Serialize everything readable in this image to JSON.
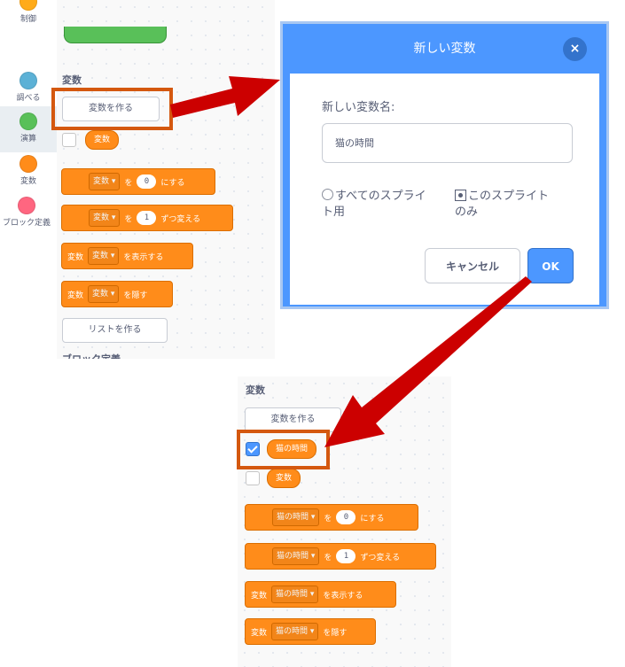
{
  "categories": [
    {
      "label": "制御",
      "color": "#ffab19"
    },
    {
      "label": "調べる",
      "color": "#5cb1d6"
    },
    {
      "label": "演算",
      "color": "#59c059"
    },
    {
      "label": "変数",
      "color": "#ff8c1a"
    },
    {
      "label": "ブロック定義",
      "color": "#ff6680"
    }
  ],
  "palette": {
    "section_title": "変数",
    "make_variable_label": "変数を作る",
    "variable_reporter": "変数",
    "set_block": {
      "var": "変数 ▾",
      "to": "を",
      "value": "0",
      "suffix": "にする"
    },
    "change_block": {
      "var": "変数 ▾",
      "by": "を",
      "value": "1",
      "suffix": "ずつ変える"
    },
    "show_block": {
      "prefix": "変数",
      "var": "変数 ▾",
      "suffix": "を表示する"
    },
    "hide_block": {
      "prefix": "変数",
      "var": "変数 ▾",
      "suffix": "を隠す"
    },
    "make_list_label": "リストを作る",
    "next_section_partial": "ブロック定義"
  },
  "dialog": {
    "title": "新しい変数",
    "close_icon": "×",
    "field_label": "新しい変数名:",
    "input_value": "猫の時間",
    "radio_all_line1": "すべてのスプライ",
    "radio_all_line2": "ト用",
    "radio_this_line1": "このスプライト",
    "radio_this_line2": "のみ",
    "cancel_label": "キャンセル",
    "ok_label": "OK"
  },
  "result_palette": {
    "section_title": "変数",
    "make_variable_label": "変数を作る",
    "new_variable": "猫の時間",
    "variable_reporter": "変数",
    "set_block": {
      "var": "猫の時間 ▾",
      "to": "を",
      "value": "0",
      "suffix": "にする"
    },
    "change_block": {
      "var": "猫の時間 ▾",
      "by": "を",
      "value": "1",
      "suffix": "ずつ変える"
    },
    "show_block": {
      "prefix": "変数",
      "var": "猫の時間 ▾",
      "suffix": "を表示する"
    },
    "hide_block": {
      "prefix": "変数",
      "var": "猫の時間 ▾",
      "suffix": "を隠す"
    }
  },
  "colors": {
    "variables": "#ff8c1a",
    "highlight": "#d4580f",
    "arrow": "#cc0000",
    "dialog_blue": "#4c97ff"
  }
}
